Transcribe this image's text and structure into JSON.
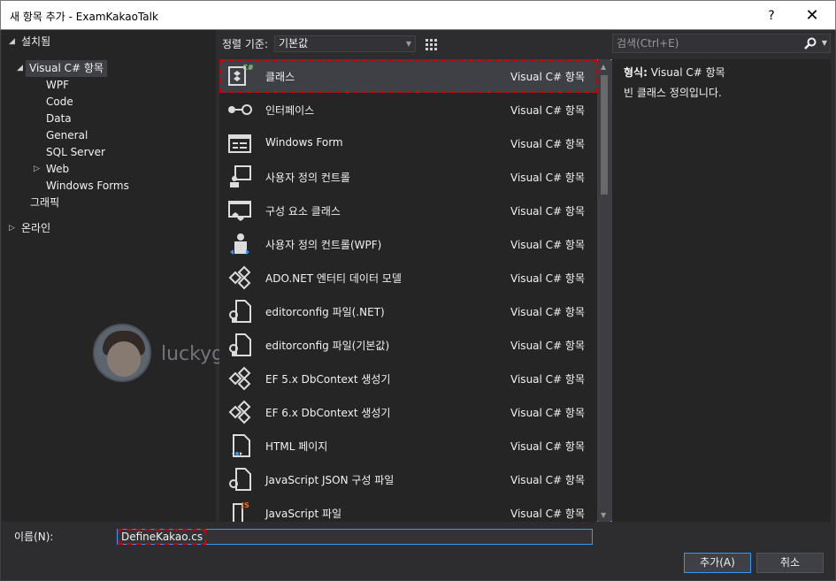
{
  "window": {
    "title": "새 항목 추가 - ExamKakaoTalk",
    "help_label": "?",
    "close_label": "✕"
  },
  "tree": {
    "installed": "설치됨",
    "visual_csharp": "Visual C# 항목",
    "children": [
      "WPF",
      "Code",
      "Data",
      "General",
      "SQL Server",
      "Web",
      "Windows Forms"
    ],
    "graphics": "그래픽",
    "online": "온라인"
  },
  "toolbar": {
    "sort_label": "정렬 기준:",
    "sort_value": "기본값"
  },
  "search": {
    "placeholder": "검색(Ctrl+E)"
  },
  "items": [
    {
      "name": "클래스",
      "category": "Visual C# 항목",
      "icon": "class-icon"
    },
    {
      "name": "인터페이스",
      "category": "Visual C# 항목",
      "icon": "interface-icon"
    },
    {
      "name": "Windows Form",
      "category": "Visual C# 항목",
      "icon": "form-icon"
    },
    {
      "name": "사용자 정의 컨트롤",
      "category": "Visual C# 항목",
      "icon": "user-control-icon"
    },
    {
      "name": "구성 요소 클래스",
      "category": "Visual C# 항목",
      "icon": "component-class-icon"
    },
    {
      "name": "사용자 정의 컨트롤(WPF)",
      "category": "Visual C# 항목",
      "icon": "wpf-user-control-icon"
    },
    {
      "name": "ADO.NET 엔터티 데이터 모델",
      "category": "Visual C# 항목",
      "icon": "entity-model-icon"
    },
    {
      "name": "editorconfig 파일(.NET)",
      "category": "Visual C# 항목",
      "icon": "editorconfig-icon"
    },
    {
      "name": "editorconfig 파일(기본값)",
      "category": "Visual C# 항목",
      "icon": "editorconfig-icon"
    },
    {
      "name": "EF 5.x DbContext 생성기",
      "category": "Visual C# 항목",
      "icon": "dbcontext-icon"
    },
    {
      "name": "EF 6.x DbContext 생성기",
      "category": "Visual C# 항목",
      "icon": "dbcontext-icon"
    },
    {
      "name": "HTML 페이지",
      "category": "Visual C# 항목",
      "icon": "html-page-icon"
    },
    {
      "name": "JavaScript JSON 구성 파일",
      "category": "Visual C# 항목",
      "icon": "json-config-icon"
    },
    {
      "name": "JavaScript 파일",
      "category": "Visual C# 항목",
      "icon": "javascript-file-icon"
    }
  ],
  "detail": {
    "type_label": "형식:",
    "type_value": "Visual C# 항목",
    "description": "빈 클래스 정의입니다."
  },
  "bottom": {
    "name_label": "이름(N):",
    "name_value": "DefineKakao.cs",
    "add_label": "추가(A)",
    "cancel_label": "취소"
  },
  "watermark": {
    "text": "luckygg.tistory.com"
  },
  "colors": {
    "background": "#2d2d30",
    "panel": "#252526",
    "accent": "#3399ff",
    "highlight_dash": "#cc0000"
  }
}
